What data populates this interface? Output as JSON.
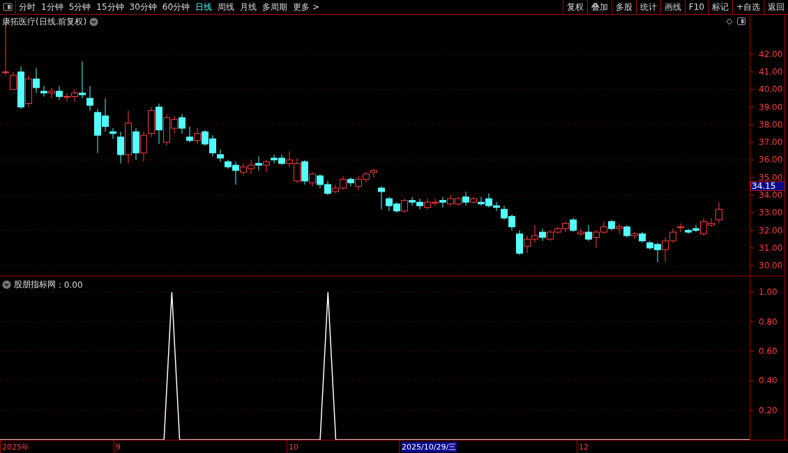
{
  "toolbar": {
    "periods": [
      {
        "label": "分时",
        "selected": false
      },
      {
        "label": "1分钟",
        "selected": false
      },
      {
        "label": "5分钟",
        "selected": false
      },
      {
        "label": "15分钟",
        "selected": false
      },
      {
        "label": "30分钟",
        "selected": false
      },
      {
        "label": "60分钟",
        "selected": false
      },
      {
        "label": "日线",
        "selected": true
      },
      {
        "label": "周线",
        "selected": false
      },
      {
        "label": "月线",
        "selected": false
      },
      {
        "label": "多周期",
        "selected": false
      },
      {
        "label": "更多 >",
        "selected": false
      }
    ],
    "buttons": [
      "复权",
      "叠加",
      "多股",
      "统计",
      "画线",
      "F10",
      "标记",
      "+自选",
      "返回"
    ]
  },
  "price_chart": {
    "title": "康拓医疗(日线.前复权)",
    "current_price": "34.15",
    "chart_data": {
      "type": "candlestick",
      "ylim": [
        29.41,
        44.25
      ],
      "grid": true,
      "yticks": [
        {
          "value": 42,
          "label": "42.00"
        },
        {
          "value": 41,
          "label": "41.00"
        },
        {
          "value": 40,
          "label": "40.00"
        },
        {
          "value": 39,
          "label": "39.00"
        },
        {
          "value": 38,
          "label": "38.00"
        },
        {
          "value": 37,
          "label": "37.00"
        },
        {
          "value": 36,
          "label": "36.00"
        },
        {
          "value": 35,
          "label": "35.00"
        },
        {
          "value": 34,
          "label": "34.00"
        },
        {
          "value": 33,
          "label": "33.00"
        },
        {
          "value": 32,
          "label": "32.00"
        },
        {
          "value": 31,
          "label": "31.00"
        },
        {
          "value": 30,
          "label": "30.00"
        }
      ],
      "ohlc": [
        [
          41,
          43.8,
          40.8,
          41
        ],
        [
          40,
          41,
          40,
          40.8
        ],
        [
          41,
          41.3,
          38.9,
          39
        ],
        [
          39.2,
          40.8,
          39,
          40.6
        ],
        [
          40.6,
          41.2,
          39.8,
          40.1
        ],
        [
          39.9,
          40.2,
          39.6,
          39.8
        ],
        [
          39.8,
          40.1,
          39.5,
          39.9
        ],
        [
          39.9,
          40.2,
          39.4,
          39.6
        ],
        [
          39.6,
          39.8,
          39.3,
          39.6
        ],
        [
          39.6,
          40,
          39.3,
          39.8
        ],
        [
          39.8,
          41.6,
          39.5,
          39.7
        ],
        [
          39.5,
          40.2,
          38.8,
          39.1
        ],
        [
          38.7,
          38.9,
          36.4,
          37.4
        ],
        [
          38.5,
          39.5,
          37.6,
          37.9
        ],
        [
          37.6,
          37.8,
          37.2,
          37.5
        ],
        [
          37.3,
          37.6,
          35.8,
          36.3
        ],
        [
          36.3,
          38.8,
          35.8,
          38.1
        ],
        [
          37.6,
          37.8,
          36,
          36.4
        ],
        [
          36.4,
          37.6,
          35.9,
          37.4
        ],
        [
          37.5,
          39,
          37.3,
          38.8
        ],
        [
          39,
          39.2,
          36.9,
          37.7
        ],
        [
          37,
          38.6,
          36.8,
          38.4
        ],
        [
          37.8,
          38.5,
          37.5,
          38.3
        ],
        [
          38.4,
          38.6,
          37.5,
          37.8
        ],
        [
          37.3,
          37.9,
          37,
          37.1
        ],
        [
          37.1,
          37.8,
          36.9,
          37.5
        ],
        [
          37.6,
          37.7,
          36.8,
          36.9
        ],
        [
          37.2,
          37.4,
          36.2,
          36.4
        ],
        [
          36.3,
          36.6,
          35.9,
          36.1
        ],
        [
          35.9,
          36,
          35.5,
          35.6
        ],
        [
          35.7,
          35.9,
          34.6,
          35.4
        ],
        [
          35.3,
          35.8,
          35.1,
          35.6
        ],
        [
          35.5,
          36,
          35.2,
          35.7
        ],
        [
          35.8,
          36.2,
          35.4,
          35.7
        ],
        [
          35.7,
          36,
          35.3,
          35.9
        ],
        [
          36.1,
          36.3,
          35.8,
          36
        ],
        [
          36.1,
          36.3,
          35.7,
          35.8
        ],
        [
          35.8,
          36.5,
          35.6,
          36
        ],
        [
          34.8,
          36.1,
          34.7,
          35.8
        ],
        [
          35.9,
          36,
          34.6,
          34.8
        ],
        [
          34.7,
          35.3,
          34.5,
          35.2
        ],
        [
          35.1,
          35.2,
          34.4,
          34.6
        ],
        [
          34.6,
          34.8,
          34,
          34.1
        ],
        [
          34.2,
          34.6,
          34.1,
          34.4
        ],
        [
          34.4,
          35.1,
          34.3,
          34.9
        ],
        [
          34.9,
          35,
          34.5,
          34.7
        ],
        [
          34.5,
          35.1,
          34.3,
          34.9
        ],
        [
          34.9,
          35.3,
          34.7,
          35.2
        ],
        [
          35.3,
          35.5,
          35,
          35.4
        ],
        [
          34.4,
          34.5,
          33.2,
          34.2
        ],
        [
          33.8,
          33.9,
          33.1,
          33.4
        ],
        [
          33.5,
          33.6,
          33,
          33.1
        ],
        [
          33.1,
          33.8,
          33,
          33.7
        ],
        [
          33.7,
          33.9,
          33.4,
          33.6
        ],
        [
          33.6,
          33.8,
          33.2,
          33.4
        ],
        [
          33.3,
          33.8,
          33.2,
          33.6
        ],
        [
          33.55,
          33.8,
          33.4,
          33.6
        ],
        [
          33.7,
          33.9,
          33.3,
          33.6
        ],
        [
          33.5,
          34,
          33.4,
          33.8
        ],
        [
          33.5,
          33.9,
          33.4,
          33.8
        ],
        [
          33.9,
          34.2,
          33.4,
          33.6
        ],
        [
          33.6,
          33.9,
          33.5,
          33.8
        ],
        [
          33.6,
          33.9,
          33.4,
          33.5
        ],
        [
          33.8,
          34.1,
          33.3,
          33.4
        ],
        [
          33.4,
          33.6,
          33.1,
          33.3
        ],
        [
          33.2,
          33.4,
          32.6,
          32.7
        ],
        [
          32.8,
          32.9,
          32,
          32.2
        ],
        [
          31.8,
          32,
          30.6,
          30.7
        ],
        [
          31.1,
          31.7,
          30.7,
          31.5
        ],
        [
          31.5,
          32.3,
          31.3,
          31.7
        ],
        [
          31.9,
          32.1,
          31.4,
          31.6
        ],
        [
          31.5,
          32,
          31.4,
          31.9
        ],
        [
          31.9,
          32.2,
          31.8,
          32.1
        ],
        [
          32.1,
          32.5,
          31.9,
          32.4
        ],
        [
          32.6,
          32.7,
          31.9,
          32
        ],
        [
          31.8,
          32.1,
          31.7,
          31.9
        ],
        [
          31.9,
          32.3,
          31.4,
          31.5
        ],
        [
          31.6,
          32,
          31,
          31.9
        ],
        [
          31.9,
          32.5,
          31.8,
          32.2
        ],
        [
          32.5,
          32.6,
          32,
          32.1
        ],
        [
          32.1,
          32.4,
          31.8,
          32.2
        ],
        [
          32.2,
          32.3,
          31.6,
          31.7
        ],
        [
          31.7,
          31.9,
          31.5,
          31.8
        ],
        [
          31.8,
          31.9,
          31.3,
          31.4
        ],
        [
          31.3,
          31.4,
          30.9,
          31
        ],
        [
          31.2,
          31.3,
          30.2,
          30.9
        ],
        [
          30.9,
          31.6,
          30.2,
          31.4
        ],
        [
          31.4,
          32.1,
          31.3,
          31.9
        ],
        [
          32.15,
          32.4,
          31.9,
          32.2
        ],
        [
          32,
          32.1,
          31.8,
          31.9
        ],
        [
          32.1,
          32.3,
          31.9,
          32
        ],
        [
          31.8,
          32.7,
          31.7,
          32.5
        ],
        [
          32.3,
          32.7,
          32.2,
          32.4
        ],
        [
          32.6,
          33.6,
          32.4,
          33.2
        ]
      ]
    }
  },
  "indicator": {
    "value": ": 0.00",
    "chart_data": {
      "type": "line",
      "ylim": [
        0,
        1.1
      ],
      "grid": true,
      "yticks": [
        {
          "value": 0.2,
          "label": "0.20"
        },
        {
          "value": 0.4,
          "label": "0.40"
        },
        {
          "value": 0.6,
          "label": "0.60"
        },
        {
          "value": 0.8,
          "label": "0.80"
        },
        {
          "value": 1.0,
          "label": "1.00"
        }
      ],
      "series": [
        {
          "name": "股朋指标网",
          "color": "#ffffff",
          "values": [
            0,
            0,
            0,
            0,
            0,
            0,
            0,
            0,
            0,
            0,
            0,
            0,
            0,
            0,
            0,
            0,
            0,
            0,
            0,
            0,
            0,
            0,
            1,
            0,
            0,
            0,
            0,
            0,
            0,
            0,
            0,
            0,
            0,
            0,
            0,
            0,
            0,
            0,
            0,
            0,
            0,
            0,
            1,
            0,
            0,
            0,
            0,
            0,
            0,
            0,
            0,
            0,
            0,
            0,
            0,
            0,
            0,
            0,
            0,
            0,
            0,
            0,
            0,
            0,
            0,
            0,
            0,
            0,
            0,
            0,
            0,
            0,
            0,
            0,
            0,
            0,
            0,
            0,
            0,
            0,
            0,
            0,
            0,
            0,
            0,
            0,
            0,
            0,
            0,
            0,
            0,
            0,
            0,
            0,
            0,
            0,
            0
          ]
        }
      ]
    }
  },
  "date_axis": [
    {
      "label": "2025年",
      "selected": false
    },
    {
      "label": "9",
      "selected": false
    },
    {
      "label": "10",
      "selected": false
    },
    {
      "label": "2025/10/29/三",
      "selected": true
    },
    {
      "label": "12",
      "selected": false
    }
  ]
}
